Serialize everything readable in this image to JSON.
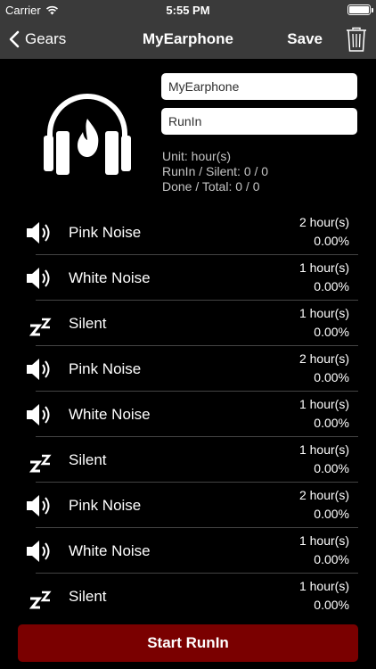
{
  "status_bar": {
    "carrier": "Carrier",
    "time": "5:55 PM"
  },
  "nav": {
    "back_label": "Gears",
    "title": "MyEarphone",
    "save_label": "Save"
  },
  "form": {
    "name_value": "MyEarphone",
    "type_value": "RunIn"
  },
  "summary": {
    "unit": "Unit: hour(s)",
    "runin_silent": "RunIn / Silent: 0 / 0",
    "done_total": "Done / Total: 0 / 0"
  },
  "steps": [
    {
      "icon": "speaker-icon",
      "label": "Pink Noise",
      "duration": "2 hour(s)",
      "progress": "0.00%"
    },
    {
      "icon": "speaker-icon",
      "label": "White Noise",
      "duration": "1 hour(s)",
      "progress": "0.00%"
    },
    {
      "icon": "sleep-zz-icon",
      "label": "Silent",
      "duration": "1 hour(s)",
      "progress": "0.00%"
    },
    {
      "icon": "speaker-icon",
      "label": "Pink Noise",
      "duration": "2 hour(s)",
      "progress": "0.00%"
    },
    {
      "icon": "speaker-icon",
      "label": "White Noise",
      "duration": "1 hour(s)",
      "progress": "0.00%"
    },
    {
      "icon": "sleep-zz-icon",
      "label": "Silent",
      "duration": "1 hour(s)",
      "progress": "0.00%"
    },
    {
      "icon": "speaker-icon",
      "label": "Pink Noise",
      "duration": "2 hour(s)",
      "progress": "0.00%"
    },
    {
      "icon": "speaker-icon",
      "label": "White Noise",
      "duration": "1 hour(s)",
      "progress": "0.00%"
    },
    {
      "icon": "sleep-zz-icon",
      "label": "Silent",
      "duration": "1 hour(s)",
      "progress": "0.00%"
    }
  ],
  "start_button_label": "Start RunIn",
  "colors": {
    "nav_bg": "#3a3a3a",
    "accent": "#7a0000",
    "background": "#000000"
  }
}
